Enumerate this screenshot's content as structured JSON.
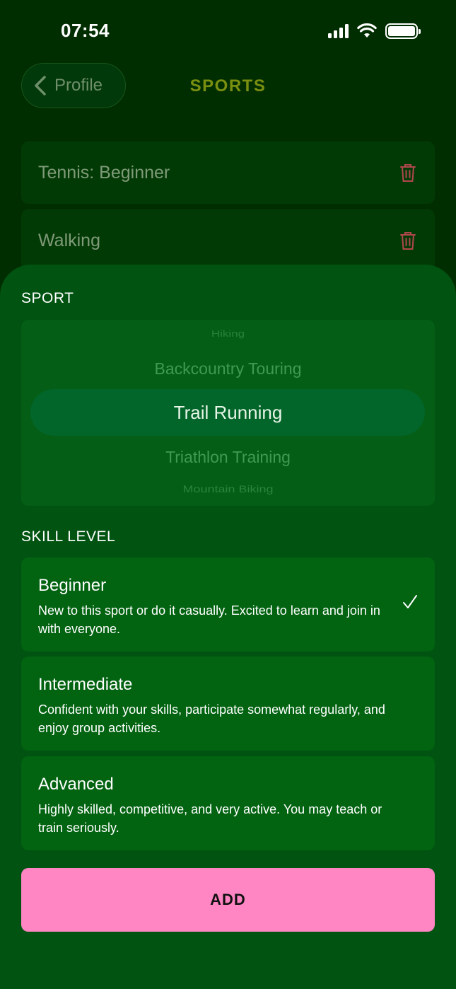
{
  "status_bar": {
    "time": "07:54"
  },
  "header": {
    "back_label": "Profile",
    "title": "SPORTS"
  },
  "sports_list": [
    {
      "label": "Tennis: Beginner"
    },
    {
      "label": "Walking"
    }
  ],
  "sheet": {
    "sport_label": "SPORT",
    "picker": {
      "items": [
        "Hiking",
        "Backcountry Touring",
        "Trail Running",
        "Triathlon Training",
        "Mountain Biking"
      ],
      "selected": "Trail Running"
    },
    "skill_label": "SKILL LEVEL",
    "skills": [
      {
        "title": "Beginner",
        "description": "New to this sport or do it casually. Excited to learn and join in with everyone.",
        "selected": true
      },
      {
        "title": "Intermediate",
        "description": "Confident with your skills, participate somewhat regularly, and enjoy group activities.",
        "selected": false
      },
      {
        "title": "Advanced",
        "description": "Highly skilled, competitive, and very active. You may teach or train seriously.",
        "selected": false
      }
    ],
    "add_label": "ADD"
  },
  "colors": {
    "background": "#012e00",
    "sheet": "#005310",
    "accent_pink": "#ff86c3",
    "title_olive": "#7a8f10",
    "delete_red": "#b0474a"
  }
}
